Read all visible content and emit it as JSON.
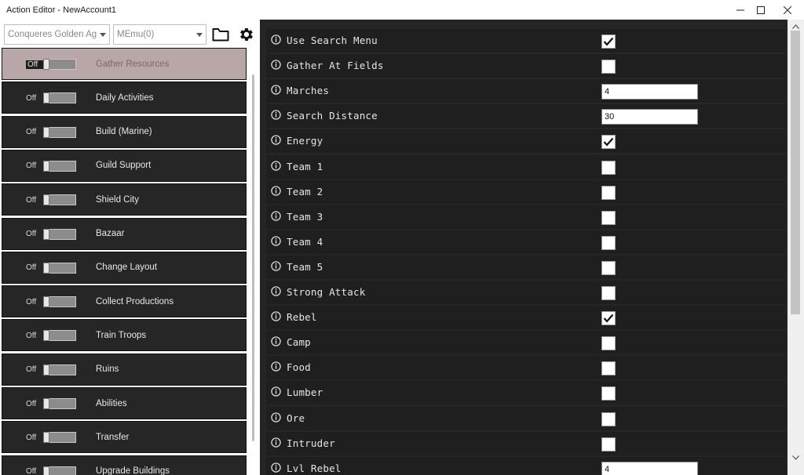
{
  "window": {
    "title": "Action Editor - NewAccount1"
  },
  "toolbar": {
    "game_value": "Conqueres Golden Age",
    "emulator_value": "MEmu(0)"
  },
  "actions": [
    {
      "label": "Gather Resources",
      "toggle": "Off",
      "selected": true
    },
    {
      "label": "Daily Activities",
      "toggle": "Off",
      "selected": false
    },
    {
      "label": "Build (Marine)",
      "toggle": "Off",
      "selected": false
    },
    {
      "label": "Guild Support",
      "toggle": "Off",
      "selected": false
    },
    {
      "label": "Shield City",
      "toggle": "Off",
      "selected": false
    },
    {
      "label": "Bazaar",
      "toggle": "Off",
      "selected": false
    },
    {
      "label": "Change Layout",
      "toggle": "Off",
      "selected": false
    },
    {
      "label": "Collect Productions",
      "toggle": "Off",
      "selected": false
    },
    {
      "label": "Train Troops",
      "toggle": "Off",
      "selected": false
    },
    {
      "label": "Ruins",
      "toggle": "Off",
      "selected": false
    },
    {
      "label": "Abilities",
      "toggle": "Off",
      "selected": false
    },
    {
      "label": "Transfer",
      "toggle": "Off",
      "selected": false
    },
    {
      "label": "Upgrade Buildings",
      "toggle": "Off",
      "selected": false
    }
  ],
  "properties": [
    {
      "label": "Use Search Menu",
      "type": "checkbox",
      "checked": true
    },
    {
      "label": "Gather At Fields",
      "type": "checkbox",
      "checked": false
    },
    {
      "label": "Marches",
      "type": "number",
      "value": "4"
    },
    {
      "label": "Search Distance",
      "type": "number",
      "value": "30"
    },
    {
      "label": "Energy",
      "type": "checkbox",
      "checked": true
    },
    {
      "label": "Team 1",
      "type": "checkbox",
      "checked": false
    },
    {
      "label": "Team 2",
      "type": "checkbox",
      "checked": false
    },
    {
      "label": "Team 3",
      "type": "checkbox",
      "checked": false
    },
    {
      "label": "Team 4",
      "type": "checkbox",
      "checked": false
    },
    {
      "label": "Team 5",
      "type": "checkbox",
      "checked": false
    },
    {
      "label": "Strong Attack",
      "type": "checkbox",
      "checked": false
    },
    {
      "label": "Rebel",
      "type": "checkbox",
      "checked": true
    },
    {
      "label": "Camp",
      "type": "checkbox",
      "checked": false
    },
    {
      "label": "Food",
      "type": "checkbox",
      "checked": false
    },
    {
      "label": "Lumber",
      "type": "checkbox",
      "checked": false
    },
    {
      "label": "Ore",
      "type": "checkbox",
      "checked": false
    },
    {
      "label": "Intruder",
      "type": "checkbox",
      "checked": false
    },
    {
      "label": "Lvl Rebel",
      "type": "number",
      "value": "4"
    }
  ],
  "colors": {
    "panel_dark": "#252525",
    "row_dark": "#1f1f1f",
    "selected_row": "#b9a6a6"
  },
  "icons": {
    "info": "info-circle-icon",
    "folder": "folder-icon",
    "settings": "gear-icon"
  }
}
